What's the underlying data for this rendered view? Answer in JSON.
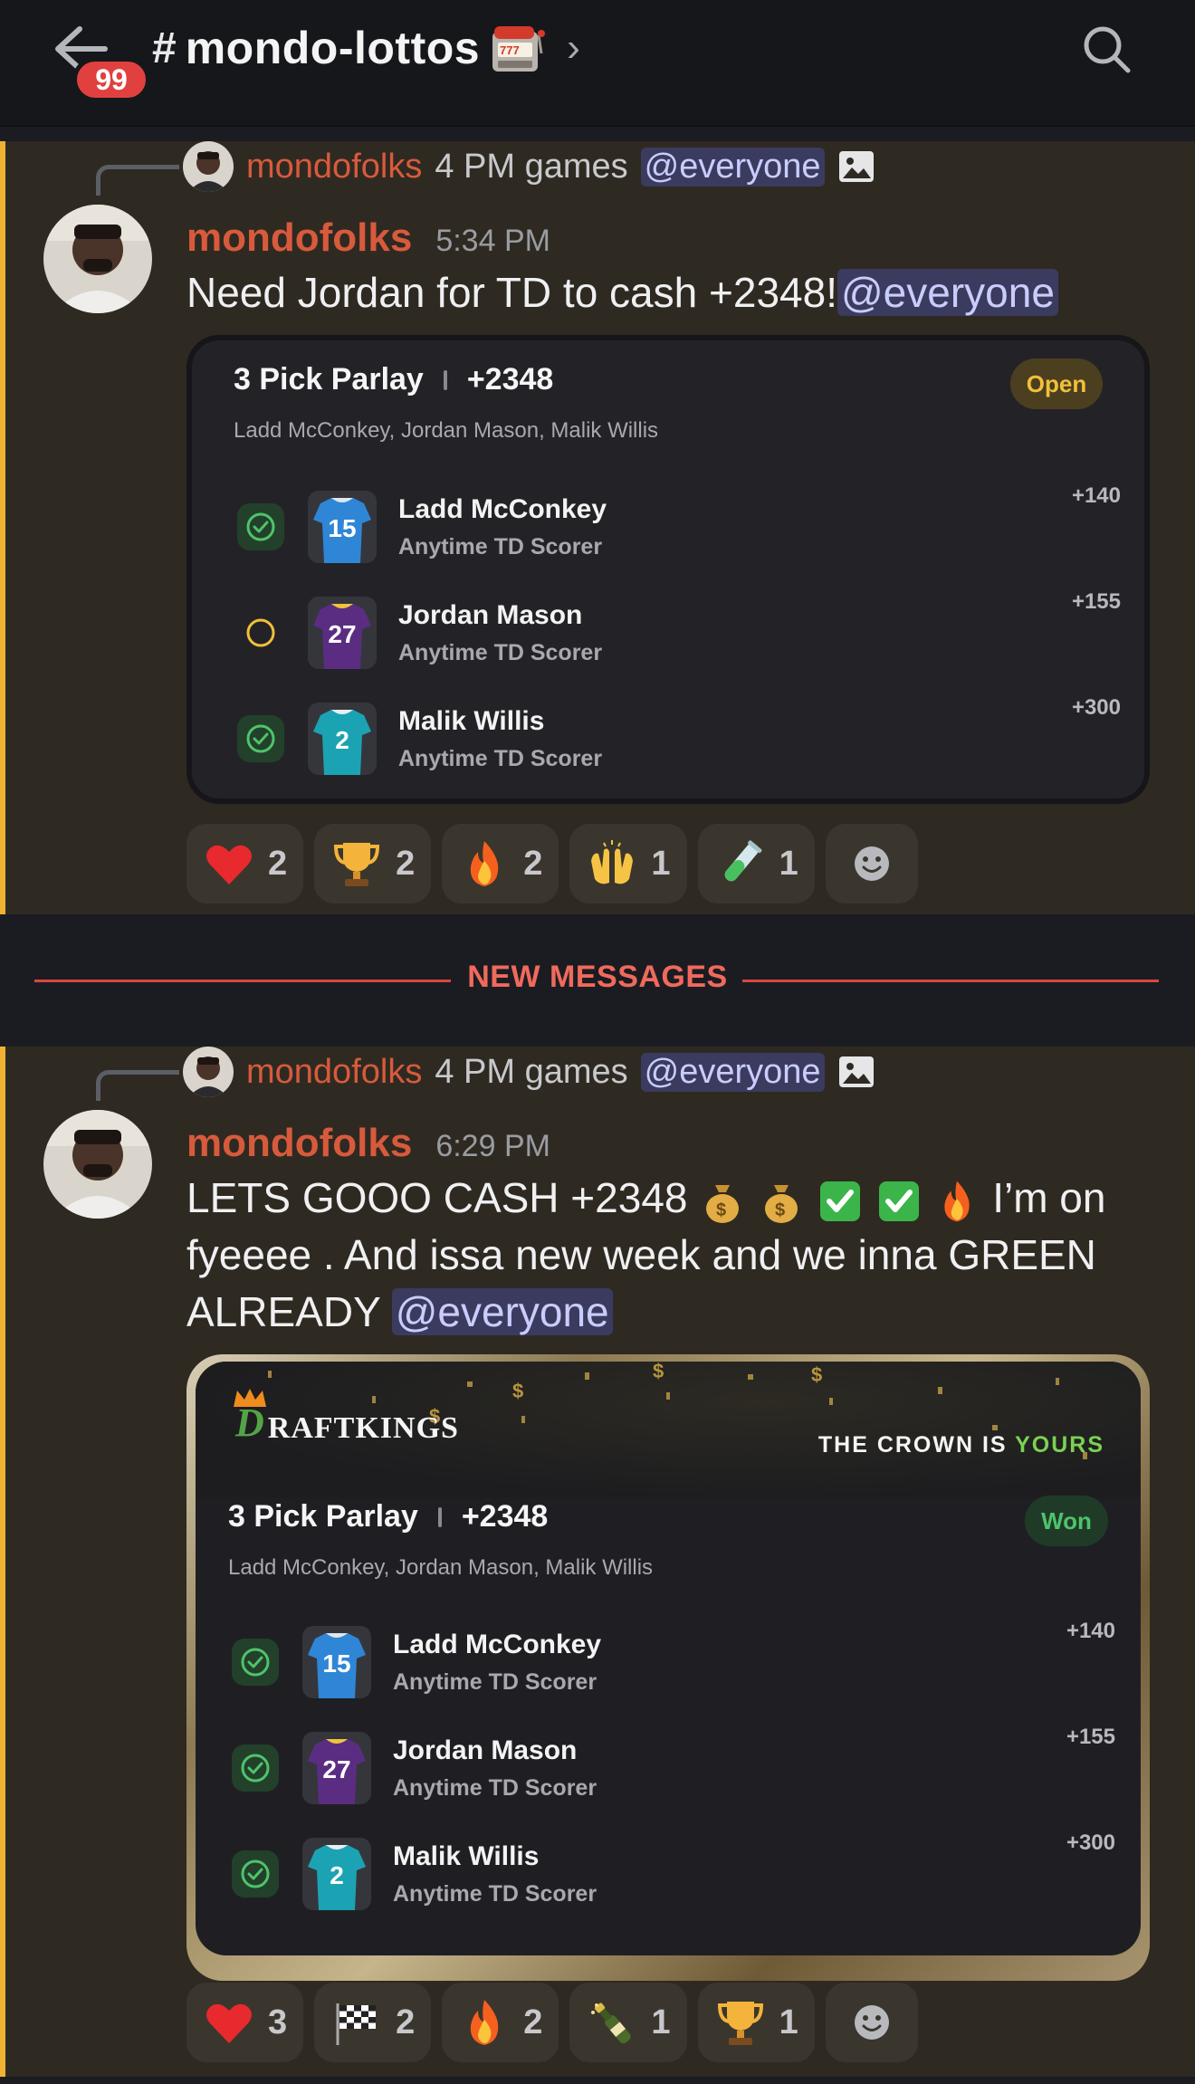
{
  "header": {
    "notification_count": "99",
    "channel_hash": "#",
    "channel_name": "mondo-lottos"
  },
  "messages": [
    {
      "reply": {
        "user": "mondofolks",
        "text": "4 PM games",
        "mention": "@everyone"
      },
      "author": "mondofolks",
      "time": "5:34 PM",
      "content": {
        "text": "Need Jordan for TD to cash +2348!",
        "mention": "@everyone"
      },
      "bet_card": {
        "title": "3 Pick Parlay",
        "odds": "+2348",
        "players": "Ladd McConkey, Jordan Mason, Malik Willis",
        "status": "Open",
        "legs": [
          {
            "player": "Ladd McConkey",
            "market": "Anytime TD Scorer",
            "odds": "+140",
            "result": "won",
            "jersey_number": "15"
          },
          {
            "player": "Jordan Mason",
            "market": "Anytime TD Scorer",
            "odds": "+155",
            "result": "pending",
            "jersey_number": "27"
          },
          {
            "player": "Malik Willis",
            "market": "Anytime TD Scorer",
            "odds": "+300",
            "result": "won",
            "jersey_number": "2"
          }
        ]
      },
      "reactions": [
        {
          "emoji": "heart",
          "count": "2"
        },
        {
          "emoji": "trophy",
          "count": "2"
        },
        {
          "emoji": "fire",
          "count": "2"
        },
        {
          "emoji": "raised-hands",
          "count": "1"
        },
        {
          "emoji": "test-tube",
          "count": "1"
        }
      ]
    },
    {
      "reply": {
        "user": "mondofolks",
        "text": "4 PM games",
        "mention": "@everyone"
      },
      "author": "mondofolks",
      "time": "6:29 PM",
      "content": {
        "part1": "LETS GOOO CASH +2348",
        "part2": " I’m on fyeeee . And issa new week and we inna GREEN ALREADY ",
        "mention": "@everyone"
      },
      "bet_card": {
        "brand_first": "D",
        "brand_rest_a": "RAFT",
        "brand_rest_b": "KINGS",
        "slogan_a": "THE CROWN IS ",
        "slogan_b": "YOURS",
        "title": "3 Pick Parlay",
        "odds": "+2348",
        "players": "Ladd McConkey, Jordan Mason, Malik Willis",
        "status": "Won",
        "legs": [
          {
            "player": "Ladd McConkey",
            "market": "Anytime TD Scorer",
            "odds": "+140",
            "result": "won",
            "jersey_number": "15"
          },
          {
            "player": "Jordan Mason",
            "market": "Anytime TD Scorer",
            "odds": "+155",
            "result": "won",
            "jersey_number": "27"
          },
          {
            "player": "Malik Willis",
            "market": "Anytime TD Scorer",
            "odds": "+300",
            "result": "won",
            "jersey_number": "2"
          }
        ]
      },
      "reactions": [
        {
          "emoji": "heart",
          "count": "3"
        },
        {
          "emoji": "checkered-flag",
          "count": "2"
        },
        {
          "emoji": "fire",
          "count": "2"
        },
        {
          "emoji": "champagne",
          "count": "1"
        },
        {
          "emoji": "trophy",
          "count": "1"
        }
      ]
    }
  ],
  "divider": {
    "label": "NEW MESSAGES"
  },
  "colors": {
    "accent_unread": "#f0b232",
    "username": "#d85a3c",
    "mention_bg": "#3f4a8a",
    "won_green": "#4ec36b",
    "open_yellow": "#f1c039",
    "divider_red": "#d9473d"
  }
}
